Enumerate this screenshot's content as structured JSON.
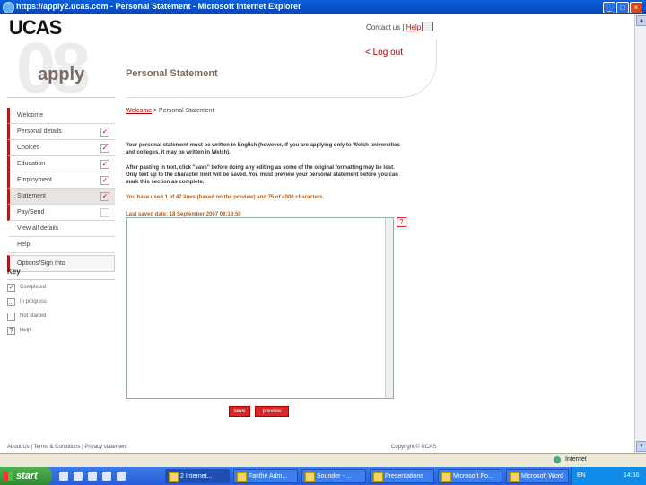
{
  "window": {
    "title": "https://apply2.ucas.com - Personal Statement - Microsoft Internet Explorer"
  },
  "header": {
    "logo": "UCAS",
    "contact": "Contact us |",
    "help": "Help",
    "logout": "< Log out",
    "bignum": "08",
    "apply": "apply",
    "page_title": "Personal Statement"
  },
  "sidebar": {
    "items": [
      {
        "label": "Welcome",
        "check": ""
      },
      {
        "label": "Personal details",
        "check": "✓"
      },
      {
        "label": "Choices",
        "check": "✓"
      },
      {
        "label": "Education",
        "check": "✓"
      },
      {
        "label": "Employment",
        "check": "✓"
      },
      {
        "label": "Statement",
        "check": "✓"
      },
      {
        "label": "Pay/Send",
        "check": ""
      },
      {
        "label": "View all details",
        "check": ""
      },
      {
        "label": "Help",
        "check": ""
      }
    ],
    "options": "Options/Sign Into"
  },
  "key": {
    "title": "Key",
    "rows": [
      {
        "label": "Completed",
        "box": "✓"
      },
      {
        "label": "In progress",
        "box": "…"
      },
      {
        "label": "Not started",
        "box": ""
      },
      {
        "label": "Help",
        "box": "?"
      }
    ]
  },
  "main": {
    "crumb_link": "Welcome",
    "crumb_rest": " > Personal Statement",
    "para1": "Your personal statement must be written in English (however, if you are applying only to Welsh universities and colleges, it may be written in Welsh).",
    "para2": "After pasting in text, click \"save\" before doing any editing as some of the original formatting may be lost. Only text up to the character limit will be saved. You must preview your personal statement before you can mark this section as complete.",
    "usage": "You have used 1 of 47 lines (based on the preview) and 75 of 4000 characters.",
    "last_saved": "Last saved date: 18 September 2007 09:18:50",
    "help_q": "?",
    "save": "save",
    "preview": "preview"
  },
  "footer": {
    "links": "About Us | Terms & Conditions | Privacy statement",
    "copyright": "Copyright © UCAS"
  },
  "statusbar": {
    "zone": "Internet"
  },
  "taskbar": {
    "start": "start",
    "tasks": [
      "2 Internet...",
      "Fasthe Adm...",
      "Sounder - ...",
      "Presentations",
      "Microsoft Po...",
      "Microsoft Word"
    ],
    "lang": "EN",
    "clock": "14:50"
  }
}
